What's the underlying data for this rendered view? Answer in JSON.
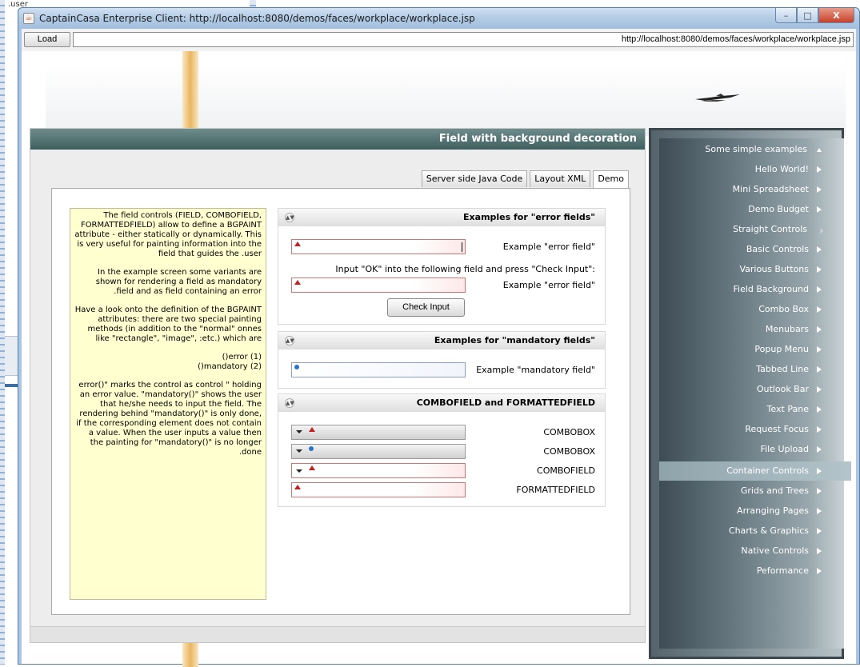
{
  "background_window": {
    "text": ".user"
  },
  "window": {
    "title": "CaptainCasa Enterprise Client: http://localhost:8080/demos/faces/workplace/workplace.jsp",
    "minimize": "–",
    "maximize": "□",
    "close": "X"
  },
  "addressbar": {
    "load_label": "Load",
    "url": "http://localhost:8080/demos/faces/workplace/workplace.jsp"
  },
  "panel": {
    "title": "Field with background decoration",
    "tabs": [
      "Server side Java Code",
      "Layout XML",
      "Demo"
    ]
  },
  "help": {
    "paragraphs": [
      "The field controls (FIELD, COMBOFIELD, FORMATTEDFIELD) allow to define a BGPAINT attribute - either statically or dynamically. This is very useful for painting information into the field that guides the .user",
      "In the example screen some variants are shown for rendering a field as mandatory .field and as field containing an error",
      "Have a look onto the definition of the BGPAINT attributes: there are two special painting methods (in addition to the \"normal\" onnes like \"rectangle\", \"image\", :etc.) which are",
      "()error (1)\n()mandatory (2)",
      "error()\" marks the control as control \" holding an error value. \"mandatory()\" shows the user that he/she needs to input the field. The rendering behind \"mandatory()\" is only done, if the corresponding element does not contain a value. When the user inputs a value then the painting for \"mandatory()\" is no longer .done"
    ]
  },
  "sections": {
    "error": {
      "title": "Examples for \"error fields\"",
      "label1": "Example \"error field\"",
      "hint": "Input \"OK\" into the following field and press \"Check Input\":",
      "label2": "Example \"error field\"",
      "check_button": "Check Input"
    },
    "mandatory": {
      "title": "Examples for \"mandatory fields\"",
      "label1": "Example \"mandatory field\""
    },
    "combo": {
      "title": "COMBOFIELD and FORMATTEDFIELD",
      "labels": [
        "COMBOBOX",
        "COMBOBOX",
        "COMBOFIELD",
        "FORMATTEDFIELD"
      ]
    }
  },
  "nav": {
    "items": [
      "Some simple examples",
      "Hello World!",
      "Mini Spreadsheet",
      "Demo Budget",
      "Straight Controls",
      "Basic Controls",
      "Various Buttons",
      "Field Background",
      "Combo Box",
      "Menubars",
      "Popup Menu",
      "Tabbed Line",
      "Outlook Bar",
      "Text Pane",
      "Request Focus",
      "File Upload",
      "Container Controls",
      "Grids and Trees",
      "Arranging Pages",
      "Charts & Graphics",
      "Native Controls",
      "Peformance"
    ],
    "selected": "Container Controls"
  },
  "colors": {
    "panel_header": "#4f6e6e",
    "help_bg": "#ffffd0",
    "error_mark": "#c02020",
    "mandatory_mark": "#2a74c8"
  }
}
